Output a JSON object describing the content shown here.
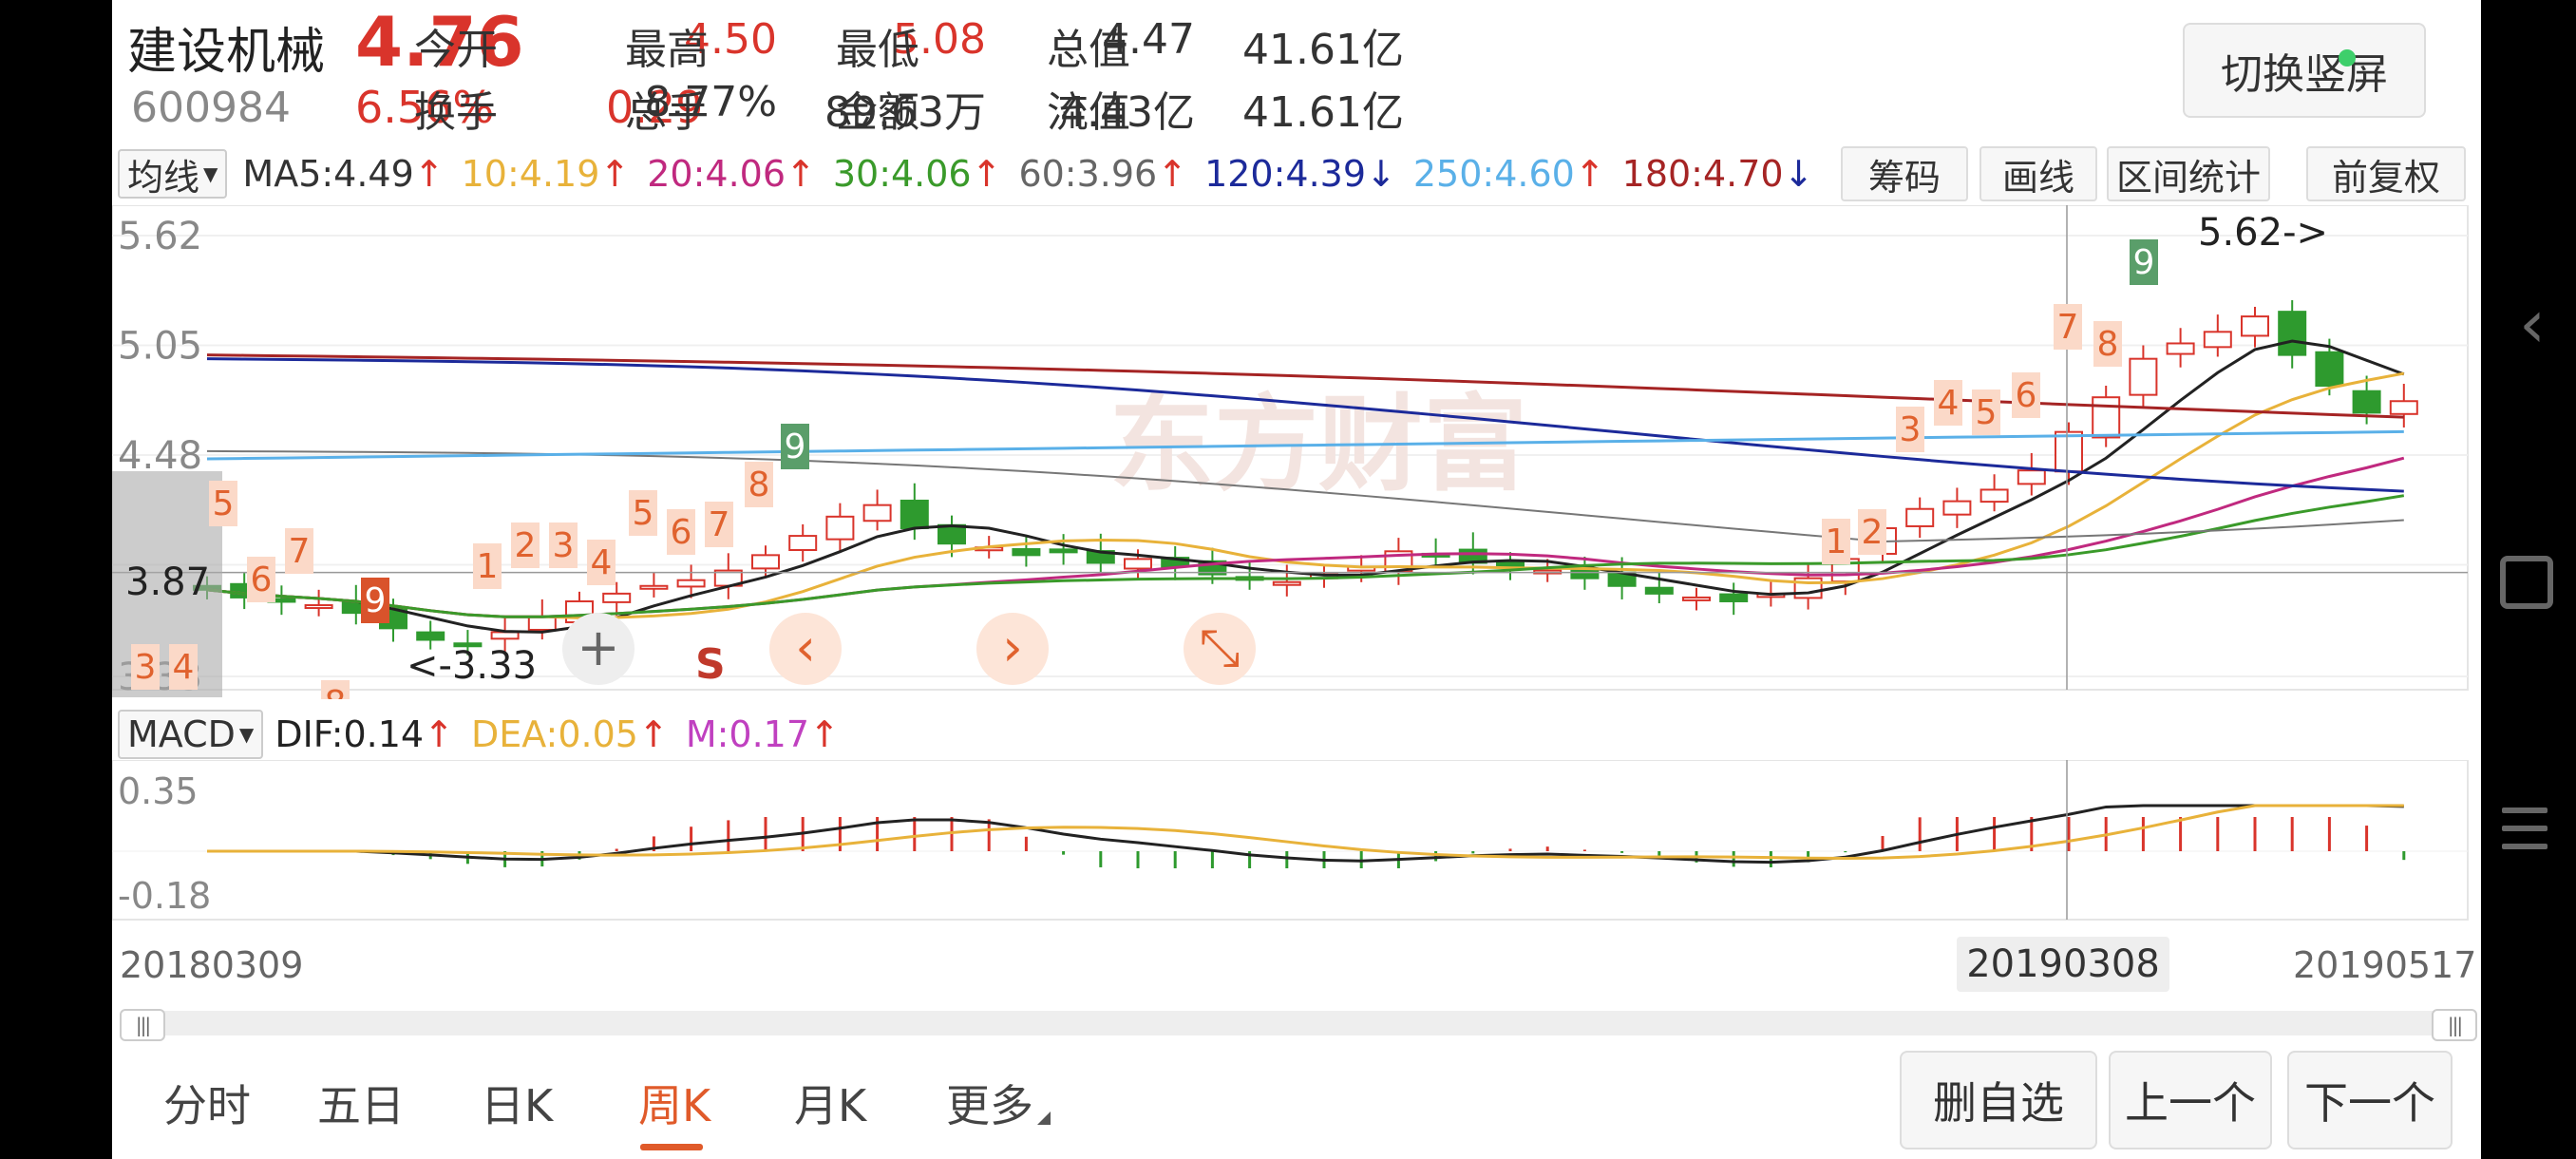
{
  "header": {
    "name": "建设机械",
    "price": "4.76",
    "code": "600984",
    "pct": "6.56%",
    "change": "0.29",
    "quote": [
      {
        "label": "今开",
        "value": "4.50",
        "color": "red"
      },
      {
        "label": "最高",
        "value": "5.08",
        "color": "red"
      },
      {
        "label": "最低",
        "value": "4.47",
        "color": "dark"
      },
      {
        "label": "总值",
        "value": "41.61亿",
        "color": "dark"
      },
      {
        "label": "换手",
        "value": "8.77%",
        "color": "dark"
      },
      {
        "label": "总手",
        "value": "89.63万",
        "color": "dark"
      },
      {
        "label": "金额",
        "value": "4.43亿",
        "color": "dark"
      },
      {
        "label": "流值",
        "value": "41.61亿",
        "color": "dark"
      }
    ],
    "switch_button": "切换竖屏"
  },
  "ma_bar": {
    "selector": "均线",
    "items": [
      {
        "text": "MA5:4.49",
        "arrow": "↑",
        "color": "#333333"
      },
      {
        "text": "10:4.19",
        "arrow": "↑",
        "color": "#e8b23a"
      },
      {
        "text": "20:4.06",
        "arrow": "↑",
        "color": "#c0297f"
      },
      {
        "text": "30:4.06",
        "arrow": "↑",
        "color": "#3a9a2a"
      },
      {
        "text": "60:3.96",
        "arrow": "↑",
        "color": "#666666"
      },
      {
        "text": "120:4.39",
        "arrow": "↓",
        "color": "#1c2a9a"
      },
      {
        "text": "250:4.60",
        "arrow": "↑",
        "color": "#5ab0e8"
      },
      {
        "text": "180:4.70",
        "arrow": "↓",
        "color": "#a52424"
      }
    ],
    "tools": [
      "筹码",
      "画线",
      "区间统计",
      "前复权"
    ]
  },
  "kline": {
    "y_labels": [
      "5.62",
      "5.05",
      "4.48",
      "3.33"
    ],
    "crosshair_price": "3.87",
    "high_marker": "5.62->",
    "low_marker": "<-3.33",
    "signal_s": "S",
    "watermark": "东方财富",
    "td_labels": [
      {
        "t": "5",
        "c": "o"
      },
      {
        "t": "6",
        "c": "o"
      },
      {
        "t": "7",
        "c": "o"
      },
      {
        "t": "3",
        "c": "o"
      },
      {
        "t": "4",
        "c": "o"
      },
      {
        "t": "8",
        "c": "o"
      },
      {
        "t": "9",
        "c": "r"
      },
      {
        "t": "1",
        "c": "o"
      },
      {
        "t": "2",
        "c": "o"
      },
      {
        "t": "3",
        "c": "o"
      },
      {
        "t": "4",
        "c": "o"
      },
      {
        "t": "5",
        "c": "o"
      },
      {
        "t": "6",
        "c": "o"
      },
      {
        "t": "7",
        "c": "o"
      },
      {
        "t": "8",
        "c": "o"
      },
      {
        "t": "9",
        "c": "g"
      },
      {
        "t": "1",
        "c": "o"
      },
      {
        "t": "2",
        "c": "o"
      },
      {
        "t": "3",
        "c": "o"
      },
      {
        "t": "4",
        "c": "o"
      },
      {
        "t": "5",
        "c": "o"
      },
      {
        "t": "6",
        "c": "o"
      },
      {
        "t": "7",
        "c": "o"
      },
      {
        "t": "8",
        "c": "o"
      },
      {
        "t": "9",
        "c": "g"
      }
    ]
  },
  "macd_bar": {
    "selector": "MACD",
    "items": [
      {
        "text": "DIF:0.14",
        "arrow": "↑",
        "color": "#222222"
      },
      {
        "text": "DEA:0.05",
        "arrow": "↑",
        "color": "#e8b23a"
      },
      {
        "text": "M:0.17",
        "arrow": "↑",
        "color": "#c040c0"
      }
    ],
    "y_labels": [
      "0.35",
      "-0.18"
    ]
  },
  "dates": {
    "start": "20180309",
    "highlight": "20190308",
    "end": "20190517"
  },
  "tabs": [
    "分时",
    "五日",
    "日K",
    "周K",
    "月K",
    "更多"
  ],
  "active_tab": "周K",
  "bottom_buttons": [
    "删自选",
    "上一个",
    "下一个"
  ]
}
